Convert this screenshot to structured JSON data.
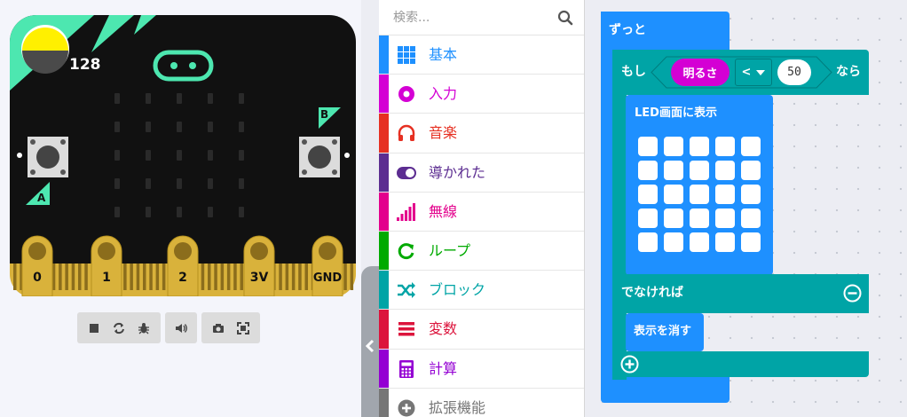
{
  "simulator": {
    "light_level": "128",
    "button_a": "A",
    "button_b": "B",
    "pins": [
      "0",
      "1",
      "2",
      "3V",
      "GND"
    ],
    "toolbar": {
      "stop": "stop",
      "restart": "restart",
      "debug": "debug",
      "mute": "mute",
      "screenshot": "screenshot",
      "fullscreen": "fullscreen"
    },
    "colors": {
      "board": "#111111",
      "pins": "#d9b23b",
      "accent": "#4de7b0",
      "light": "#fff000"
    }
  },
  "toolbox": {
    "search_placeholder": "検索...",
    "categories": [
      {
        "label": "基本",
        "color": "#1e90ff",
        "icon": "grid-icon"
      },
      {
        "label": "入力",
        "color": "#d400d4",
        "icon": "radio-icon"
      },
      {
        "label": "音楽",
        "color": "#e63022",
        "icon": "headphones-icon"
      },
      {
        "label": "導かれた",
        "color": "#5c2d91",
        "icon": "toggle-icon"
      },
      {
        "label": "無線",
        "color": "#e3008c",
        "icon": "signal-icon"
      },
      {
        "label": "ループ",
        "color": "#00aa00",
        "icon": "loop-icon"
      },
      {
        "label": "ブロック",
        "color": "#00a4a6",
        "icon": "shuffle-icon"
      },
      {
        "label": "変数",
        "color": "#dc143c",
        "icon": "list-icon"
      },
      {
        "label": "計算",
        "color": "#9400d3",
        "icon": "calculator-icon"
      },
      {
        "label": "拡張機能",
        "color": "#767676",
        "icon": "plus-circle-icon"
      }
    ]
  },
  "workspace": {
    "forever_label": "ずっと",
    "if_label": "もし",
    "then_label": "なら",
    "light_label": "明るさ",
    "operator_label": "<",
    "compare_value": "50",
    "show_leds_label": "LED画面に表示",
    "else_label": "でなければ",
    "clear_label": "表示を消す",
    "colors": {
      "loops": "#1e90ff",
      "logic": "#00a4a6",
      "input": "#d400d4",
      "basic": "#1e90ff"
    }
  }
}
